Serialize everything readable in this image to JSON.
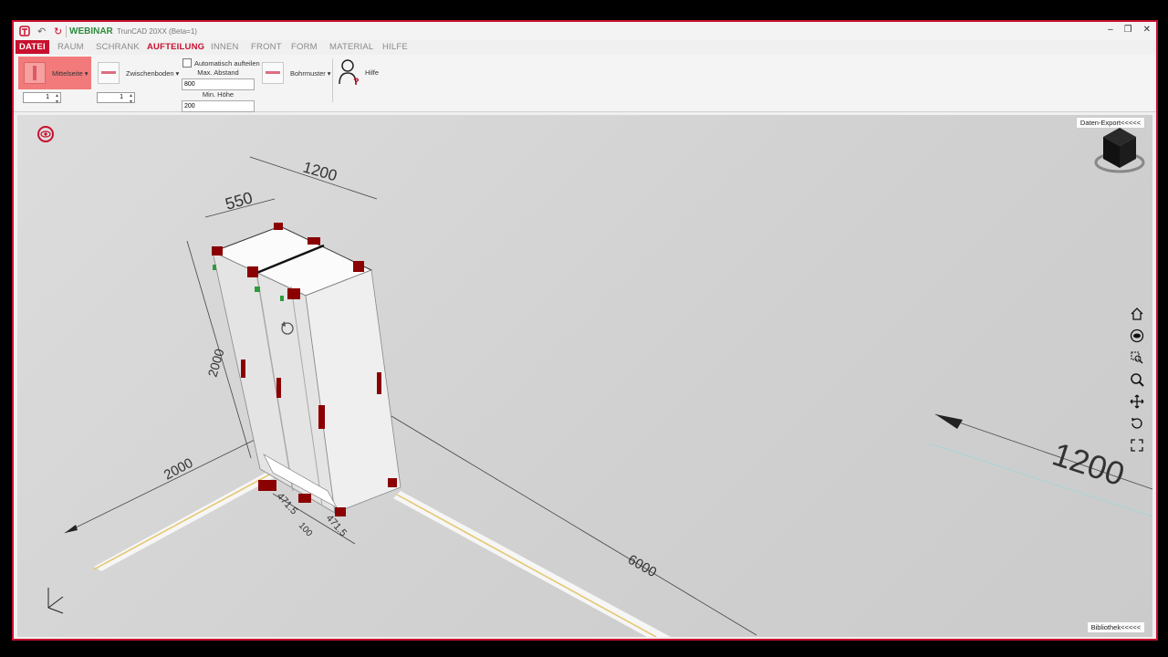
{
  "titlebar": {
    "workspace": "WEBINAR",
    "app_title": "TrunCAD 20XX (Beta=1)",
    "undo_icon": "undo-icon",
    "redo_icon": "redo-icon",
    "minimize": "–",
    "maximize": "❐",
    "close": "✕"
  },
  "menu": {
    "file": "DATEI",
    "items": [
      "RAUM",
      "SCHRANK",
      "AUFTEILUNG",
      "INNEN",
      "FRONT",
      "FORM",
      "MATERIAL",
      "HILFE"
    ],
    "active": "AUFTEILUNG"
  },
  "ribbon": {
    "mittelseite": {
      "label": "Mittelseite",
      "count": "1"
    },
    "zwischenboden": {
      "label": "Zwischenboden",
      "count": "1"
    },
    "auto_split_label": "Automatisch aufteilen",
    "max_abstand_label": "Max. Abstand",
    "max_abstand_value": "800",
    "min_hoehe_label": "Min. Höhe",
    "min_hoehe_value": "200",
    "bohrmuster_label": "Bohrmuster",
    "hilfe_label": "Hilfe"
  },
  "viewport": {
    "export_label": "Daten-Export<<<<<",
    "library_label": "Bibliothek<<<<<",
    "dimensions": {
      "width": "1200",
      "depth": "550",
      "height": "2000",
      "room_left": "2000",
      "room_right": "6000",
      "compartment_left": "471.5",
      "compartment_right": "471.5",
      "center": "100",
      "wall_big": "1200"
    },
    "nav_icons": [
      "home-icon",
      "view-icon",
      "zoom-window-icon",
      "zoom-icon",
      "pan-icon",
      "rotate-icon",
      "fit-screen-icon"
    ]
  },
  "colors": {
    "accent": "#c8102e",
    "workspace": "#2e8b3c",
    "hardware": "#8b0000"
  }
}
